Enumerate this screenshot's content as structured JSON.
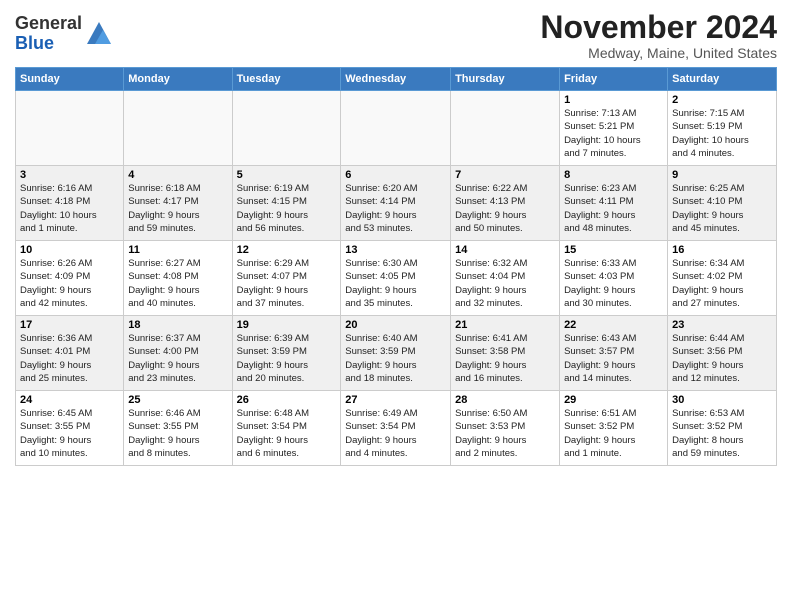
{
  "header": {
    "logo_line1": "General",
    "logo_line2": "Blue",
    "month": "November 2024",
    "location": "Medway, Maine, United States"
  },
  "weekdays": [
    "Sunday",
    "Monday",
    "Tuesday",
    "Wednesday",
    "Thursday",
    "Friday",
    "Saturday"
  ],
  "weeks": [
    [
      {
        "day": "",
        "detail": ""
      },
      {
        "day": "",
        "detail": ""
      },
      {
        "day": "",
        "detail": ""
      },
      {
        "day": "",
        "detail": ""
      },
      {
        "day": "",
        "detail": ""
      },
      {
        "day": "1",
        "detail": "Sunrise: 7:13 AM\nSunset: 5:21 PM\nDaylight: 10 hours\nand 7 minutes."
      },
      {
        "day": "2",
        "detail": "Sunrise: 7:15 AM\nSunset: 5:19 PM\nDaylight: 10 hours\nand 4 minutes."
      }
    ],
    [
      {
        "day": "3",
        "detail": "Sunrise: 6:16 AM\nSunset: 4:18 PM\nDaylight: 10 hours\nand 1 minute."
      },
      {
        "day": "4",
        "detail": "Sunrise: 6:18 AM\nSunset: 4:17 PM\nDaylight: 9 hours\nand 59 minutes."
      },
      {
        "day": "5",
        "detail": "Sunrise: 6:19 AM\nSunset: 4:15 PM\nDaylight: 9 hours\nand 56 minutes."
      },
      {
        "day": "6",
        "detail": "Sunrise: 6:20 AM\nSunset: 4:14 PM\nDaylight: 9 hours\nand 53 minutes."
      },
      {
        "day": "7",
        "detail": "Sunrise: 6:22 AM\nSunset: 4:13 PM\nDaylight: 9 hours\nand 50 minutes."
      },
      {
        "day": "8",
        "detail": "Sunrise: 6:23 AM\nSunset: 4:11 PM\nDaylight: 9 hours\nand 48 minutes."
      },
      {
        "day": "9",
        "detail": "Sunrise: 6:25 AM\nSunset: 4:10 PM\nDaylight: 9 hours\nand 45 minutes."
      }
    ],
    [
      {
        "day": "10",
        "detail": "Sunrise: 6:26 AM\nSunset: 4:09 PM\nDaylight: 9 hours\nand 42 minutes."
      },
      {
        "day": "11",
        "detail": "Sunrise: 6:27 AM\nSunset: 4:08 PM\nDaylight: 9 hours\nand 40 minutes."
      },
      {
        "day": "12",
        "detail": "Sunrise: 6:29 AM\nSunset: 4:07 PM\nDaylight: 9 hours\nand 37 minutes."
      },
      {
        "day": "13",
        "detail": "Sunrise: 6:30 AM\nSunset: 4:05 PM\nDaylight: 9 hours\nand 35 minutes."
      },
      {
        "day": "14",
        "detail": "Sunrise: 6:32 AM\nSunset: 4:04 PM\nDaylight: 9 hours\nand 32 minutes."
      },
      {
        "day": "15",
        "detail": "Sunrise: 6:33 AM\nSunset: 4:03 PM\nDaylight: 9 hours\nand 30 minutes."
      },
      {
        "day": "16",
        "detail": "Sunrise: 6:34 AM\nSunset: 4:02 PM\nDaylight: 9 hours\nand 27 minutes."
      }
    ],
    [
      {
        "day": "17",
        "detail": "Sunrise: 6:36 AM\nSunset: 4:01 PM\nDaylight: 9 hours\nand 25 minutes."
      },
      {
        "day": "18",
        "detail": "Sunrise: 6:37 AM\nSunset: 4:00 PM\nDaylight: 9 hours\nand 23 minutes."
      },
      {
        "day": "19",
        "detail": "Sunrise: 6:39 AM\nSunset: 3:59 PM\nDaylight: 9 hours\nand 20 minutes."
      },
      {
        "day": "20",
        "detail": "Sunrise: 6:40 AM\nSunset: 3:59 PM\nDaylight: 9 hours\nand 18 minutes."
      },
      {
        "day": "21",
        "detail": "Sunrise: 6:41 AM\nSunset: 3:58 PM\nDaylight: 9 hours\nand 16 minutes."
      },
      {
        "day": "22",
        "detail": "Sunrise: 6:43 AM\nSunset: 3:57 PM\nDaylight: 9 hours\nand 14 minutes."
      },
      {
        "day": "23",
        "detail": "Sunrise: 6:44 AM\nSunset: 3:56 PM\nDaylight: 9 hours\nand 12 minutes."
      }
    ],
    [
      {
        "day": "24",
        "detail": "Sunrise: 6:45 AM\nSunset: 3:55 PM\nDaylight: 9 hours\nand 10 minutes."
      },
      {
        "day": "25",
        "detail": "Sunrise: 6:46 AM\nSunset: 3:55 PM\nDaylight: 9 hours\nand 8 minutes."
      },
      {
        "day": "26",
        "detail": "Sunrise: 6:48 AM\nSunset: 3:54 PM\nDaylight: 9 hours\nand 6 minutes."
      },
      {
        "day": "27",
        "detail": "Sunrise: 6:49 AM\nSunset: 3:54 PM\nDaylight: 9 hours\nand 4 minutes."
      },
      {
        "day": "28",
        "detail": "Sunrise: 6:50 AM\nSunset: 3:53 PM\nDaylight: 9 hours\nand 2 minutes."
      },
      {
        "day": "29",
        "detail": "Sunrise: 6:51 AM\nSunset: 3:52 PM\nDaylight: 9 hours\nand 1 minute."
      },
      {
        "day": "30",
        "detail": "Sunrise: 6:53 AM\nSunset: 3:52 PM\nDaylight: 8 hours\nand 59 minutes."
      }
    ]
  ]
}
